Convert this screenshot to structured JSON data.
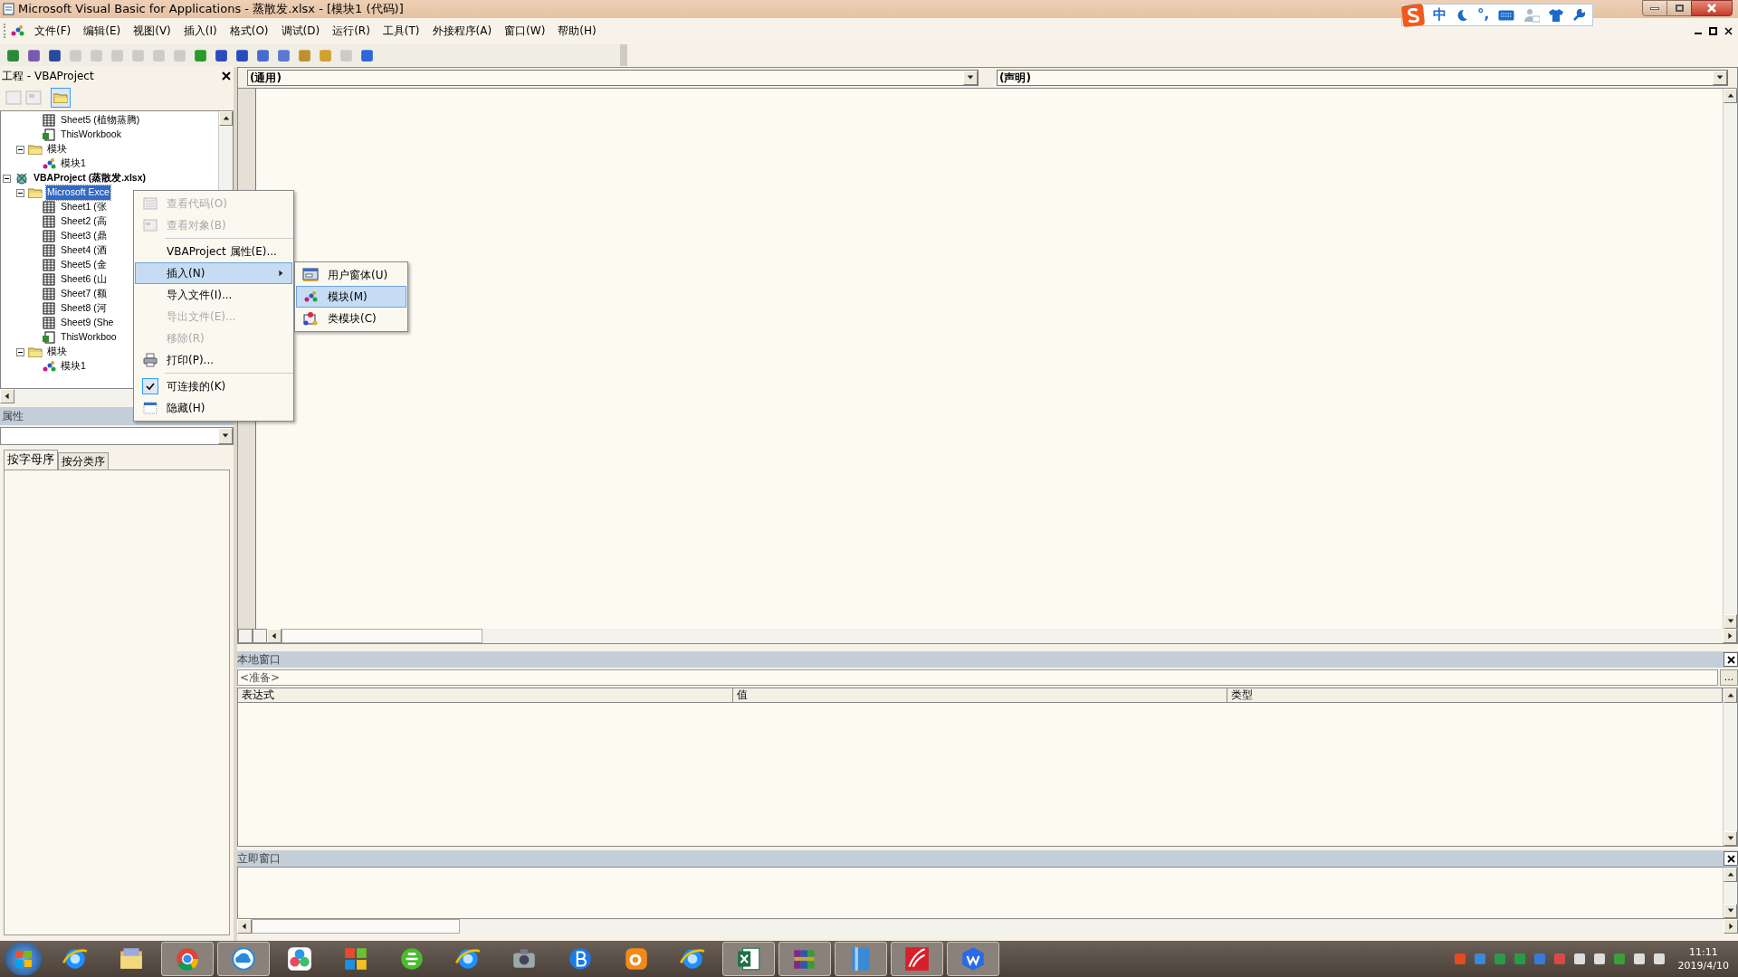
{
  "window": {
    "title": "Microsoft Visual Basic for Applications - 蒸散发.xlsx - [模块1 (代码)]"
  },
  "ime_bar": {
    "items": [
      {
        "kind": "logo"
      },
      {
        "kind": "text",
        "text": "中"
      },
      {
        "kind": "moon"
      },
      {
        "kind": "text",
        "text": "°,"
      },
      {
        "kind": "keyboard"
      },
      {
        "kind": "person"
      },
      {
        "kind": "shirt"
      },
      {
        "kind": "wrench"
      }
    ]
  },
  "menu_bar": [
    "文件(F)",
    "编辑(E)",
    "视图(V)",
    "插入(I)",
    "格式(O)",
    "调试(D)",
    "运行(R)",
    "工具(T)",
    "外接程序(A)",
    "窗口(W)",
    "帮助(H)"
  ],
  "project_pane": {
    "title": "工程 - VBAProject",
    "tree": [
      {
        "children": [
          {
            "children": [
              {
                "kind": "sheet",
                "label": "Sheet5 (植物蒸腾)"
              },
              {
                "kind": "workbook",
                "label": "ThisWorkbook"
              }
            ]
          },
          {
            "kind": "folder",
            "label": "模块",
            "expanded": true,
            "children": [
              {
                "kind": "module",
                "label": "模块1"
              }
            ]
          }
        ]
      },
      {
        "kind": "project",
        "label": "VBAProject (蒸散发.xlsx)",
        "expanded": true,
        "children": [
          {
            "kind": "folder",
            "label": "Microsoft Exce",
            "expanded": true,
            "selected": true,
            "children": [
              {
                "kind": "sheet",
                "label": "Sheet1 (张"
              },
              {
                "kind": "sheet",
                "label": "Sheet2 (高"
              },
              {
                "kind": "sheet",
                "label": "Sheet3 (鼎"
              },
              {
                "kind": "sheet",
                "label": "Sheet4 (酒"
              },
              {
                "kind": "sheet",
                "label": "Sheet5 (金"
              },
              {
                "kind": "sheet",
                "label": "Sheet6 (山"
              },
              {
                "kind": "sheet",
                "label": "Sheet7 (额"
              },
              {
                "kind": "sheet",
                "label": "Sheet8 (河"
              },
              {
                "kind": "sheet",
                "label": "Sheet9 (She"
              },
              {
                "kind": "workbook",
                "label": "ThisWorkboo"
              }
            ]
          },
          {
            "kind": "folder",
            "label": "模块",
            "expanded": true,
            "children": [
              {
                "kind": "module",
                "label": "模块1"
              }
            ]
          }
        ]
      }
    ]
  },
  "context_menu": {
    "items": [
      {
        "kind": "item",
        "label": "查看代码(O)",
        "disabled": true
      },
      {
        "kind": "item",
        "label": "查看对象(B)",
        "disabled": true
      },
      {
        "kind": "separator"
      },
      {
        "kind": "item",
        "label": "VBAProject 属性(E)..."
      },
      {
        "kind": "item",
        "label": "插入(N)",
        "selected": true,
        "submenu": true
      },
      {
        "kind": "item",
        "label": "导入文件(I)..."
      },
      {
        "kind": "item",
        "label": "导出文件(E)...",
        "disabled": true
      },
      {
        "kind": "item",
        "label": "移除(R)",
        "disabled": true
      },
      {
        "kind": "item",
        "label": "打印(P)..."
      },
      {
        "kind": "separator"
      },
      {
        "kind": "item",
        "label": "可连接的(K)",
        "checked": true
      },
      {
        "kind": "item",
        "label": "隐藏(H)"
      }
    ]
  },
  "submenu": {
    "items": [
      {
        "label": "用户窗体(U)",
        "selected": false
      },
      {
        "label": "模块(M)",
        "selected": true
      },
      {
        "label": "类模块(C)",
        "selected": false
      }
    ]
  },
  "properties_pane": {
    "title": "属性",
    "tabs": [
      {
        "label": "按字母序",
        "selected": true
      },
      {
        "label": "按分类序",
        "selected": false
      }
    ]
  },
  "code_window": {
    "object_combo": "(通用)",
    "procedure_combo": "(声明)"
  },
  "locals_window": {
    "title": "本地窗口",
    "context": "<准备>",
    "button": "...",
    "columns": [
      "表达式",
      "值",
      "类型"
    ]
  },
  "immediate_window": {
    "title": "立即窗口"
  },
  "taskbar": {
    "apps": [
      {
        "kind": "ie",
        "running": false
      },
      {
        "kind": "files",
        "running": false
      },
      {
        "kind": "chrome",
        "running": true
      },
      {
        "kind": "cloud",
        "running": true
      },
      {
        "kind": "pinwheel",
        "running": false
      },
      {
        "kind": "tiles",
        "running": false
      },
      {
        "kind": "green-e",
        "running": false
      },
      {
        "kind": "ie",
        "running": false
      },
      {
        "kind": "camera",
        "running": false
      },
      {
        "kind": "b",
        "running": false
      },
      {
        "kind": "uc",
        "running": false
      },
      {
        "kind": "ie",
        "running": false
      },
      {
        "kind": "excel",
        "running": true
      },
      {
        "kind": "winrar",
        "running": true
      },
      {
        "kind": "book",
        "running": true
      },
      {
        "kind": "red",
        "running": true
      },
      {
        "kind": "w",
        "running": true
      }
    ],
    "clock": {
      "time": "11:11",
      "date": "2019/4/10"
    }
  }
}
